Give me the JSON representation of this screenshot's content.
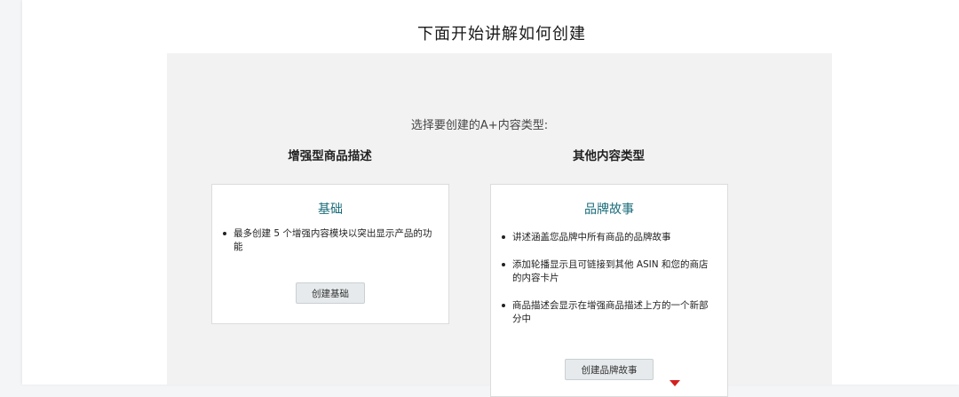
{
  "article": {
    "heading": "下面开始讲解如何创建"
  },
  "chooser": {
    "prompt": "选择要创建的A+内容类型:",
    "columns": [
      {
        "title": "增强型商品描述",
        "card_title": "基础",
        "bullets": [
          "最多创建 5 个增强内容模块以突出显示产品的功能"
        ],
        "button": "创建基础"
      },
      {
        "title": "其他内容类型",
        "card_title": "品牌故事",
        "bullets": [
          "讲述涵盖您品牌中所有商品的品牌故事",
          "添加轮播显示且可链接到其他 ASIN 和您的商店的内容卡片",
          "商品描述会显示在增强商品描述上方的一个新部分中"
        ],
        "button": "创建品牌故事"
      }
    ]
  },
  "colors": {
    "accent": "#1a6c7a",
    "panel_bg": "#f2f2f2",
    "button_bg": "#e6eaec"
  }
}
